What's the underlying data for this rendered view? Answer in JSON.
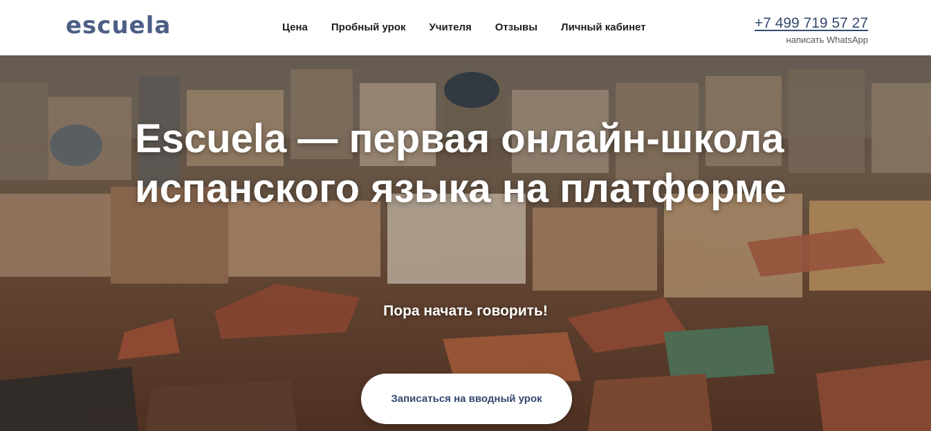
{
  "header": {
    "logo_text": "escuela",
    "nav": [
      {
        "label": "Цена"
      },
      {
        "label": "Пробный урок"
      },
      {
        "label": "Учителя"
      },
      {
        "label": "Отзывы"
      },
      {
        "label": "Личный кабинет"
      }
    ],
    "phone": "+7 499 719 57 27",
    "whatsapp_link": "написать WhatsApp"
  },
  "hero": {
    "title_line1": "Escuela — первая онлайн-школа",
    "title_line2": "испанского языка на платформе",
    "subtitle": "Пора начать говорить!",
    "cta_label": "Записаться на вводный урок",
    "background_image": "aerial-city-rooftops-photo"
  },
  "colors": {
    "brand": "#4c5f86",
    "phone": "#34496f",
    "cta_text": "#34496f",
    "nav_text": "#1d1d1d"
  }
}
